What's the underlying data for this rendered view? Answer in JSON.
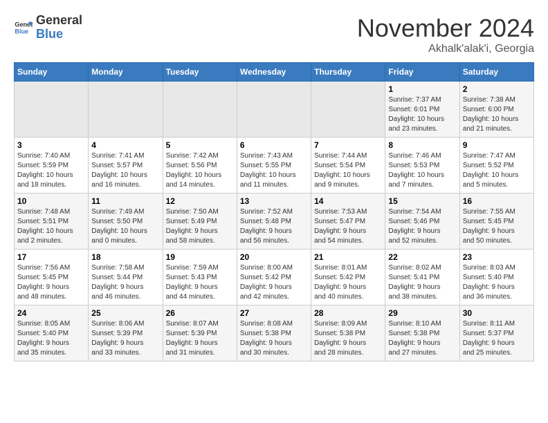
{
  "logo": {
    "line1": "General",
    "line2": "Blue"
  },
  "title": "November 2024",
  "location": "Akhalk'alak'i, Georgia",
  "days_of_week": [
    "Sunday",
    "Monday",
    "Tuesday",
    "Wednesday",
    "Thursday",
    "Friday",
    "Saturday"
  ],
  "weeks": [
    [
      {
        "num": "",
        "info": ""
      },
      {
        "num": "",
        "info": ""
      },
      {
        "num": "",
        "info": ""
      },
      {
        "num": "",
        "info": ""
      },
      {
        "num": "",
        "info": ""
      },
      {
        "num": "1",
        "info": "Sunrise: 7:37 AM\nSunset: 6:01 PM\nDaylight: 10 hours\nand 23 minutes."
      },
      {
        "num": "2",
        "info": "Sunrise: 7:38 AM\nSunset: 6:00 PM\nDaylight: 10 hours\nand 21 minutes."
      }
    ],
    [
      {
        "num": "3",
        "info": "Sunrise: 7:40 AM\nSunset: 5:59 PM\nDaylight: 10 hours\nand 18 minutes."
      },
      {
        "num": "4",
        "info": "Sunrise: 7:41 AM\nSunset: 5:57 PM\nDaylight: 10 hours\nand 16 minutes."
      },
      {
        "num": "5",
        "info": "Sunrise: 7:42 AM\nSunset: 5:56 PM\nDaylight: 10 hours\nand 14 minutes."
      },
      {
        "num": "6",
        "info": "Sunrise: 7:43 AM\nSunset: 5:55 PM\nDaylight: 10 hours\nand 11 minutes."
      },
      {
        "num": "7",
        "info": "Sunrise: 7:44 AM\nSunset: 5:54 PM\nDaylight: 10 hours\nand 9 minutes."
      },
      {
        "num": "8",
        "info": "Sunrise: 7:46 AM\nSunset: 5:53 PM\nDaylight: 10 hours\nand 7 minutes."
      },
      {
        "num": "9",
        "info": "Sunrise: 7:47 AM\nSunset: 5:52 PM\nDaylight: 10 hours\nand 5 minutes."
      }
    ],
    [
      {
        "num": "10",
        "info": "Sunrise: 7:48 AM\nSunset: 5:51 PM\nDaylight: 10 hours\nand 2 minutes."
      },
      {
        "num": "11",
        "info": "Sunrise: 7:49 AM\nSunset: 5:50 PM\nDaylight: 10 hours\nand 0 minutes."
      },
      {
        "num": "12",
        "info": "Sunrise: 7:50 AM\nSunset: 5:49 PM\nDaylight: 9 hours\nand 58 minutes."
      },
      {
        "num": "13",
        "info": "Sunrise: 7:52 AM\nSunset: 5:48 PM\nDaylight: 9 hours\nand 56 minutes."
      },
      {
        "num": "14",
        "info": "Sunrise: 7:53 AM\nSunset: 5:47 PM\nDaylight: 9 hours\nand 54 minutes."
      },
      {
        "num": "15",
        "info": "Sunrise: 7:54 AM\nSunset: 5:46 PM\nDaylight: 9 hours\nand 52 minutes."
      },
      {
        "num": "16",
        "info": "Sunrise: 7:55 AM\nSunset: 5:45 PM\nDaylight: 9 hours\nand 50 minutes."
      }
    ],
    [
      {
        "num": "17",
        "info": "Sunrise: 7:56 AM\nSunset: 5:45 PM\nDaylight: 9 hours\nand 48 minutes."
      },
      {
        "num": "18",
        "info": "Sunrise: 7:58 AM\nSunset: 5:44 PM\nDaylight: 9 hours\nand 46 minutes."
      },
      {
        "num": "19",
        "info": "Sunrise: 7:59 AM\nSunset: 5:43 PM\nDaylight: 9 hours\nand 44 minutes."
      },
      {
        "num": "20",
        "info": "Sunrise: 8:00 AM\nSunset: 5:42 PM\nDaylight: 9 hours\nand 42 minutes."
      },
      {
        "num": "21",
        "info": "Sunrise: 8:01 AM\nSunset: 5:42 PM\nDaylight: 9 hours\nand 40 minutes."
      },
      {
        "num": "22",
        "info": "Sunrise: 8:02 AM\nSunset: 5:41 PM\nDaylight: 9 hours\nand 38 minutes."
      },
      {
        "num": "23",
        "info": "Sunrise: 8:03 AM\nSunset: 5:40 PM\nDaylight: 9 hours\nand 36 minutes."
      }
    ],
    [
      {
        "num": "24",
        "info": "Sunrise: 8:05 AM\nSunset: 5:40 PM\nDaylight: 9 hours\nand 35 minutes."
      },
      {
        "num": "25",
        "info": "Sunrise: 8:06 AM\nSunset: 5:39 PM\nDaylight: 9 hours\nand 33 minutes."
      },
      {
        "num": "26",
        "info": "Sunrise: 8:07 AM\nSunset: 5:39 PM\nDaylight: 9 hours\nand 31 minutes."
      },
      {
        "num": "27",
        "info": "Sunrise: 8:08 AM\nSunset: 5:38 PM\nDaylight: 9 hours\nand 30 minutes."
      },
      {
        "num": "28",
        "info": "Sunrise: 8:09 AM\nSunset: 5:38 PM\nDaylight: 9 hours\nand 28 minutes."
      },
      {
        "num": "29",
        "info": "Sunrise: 8:10 AM\nSunset: 5:38 PM\nDaylight: 9 hours\nand 27 minutes."
      },
      {
        "num": "30",
        "info": "Sunrise: 8:11 AM\nSunset: 5:37 PM\nDaylight: 9 hours\nand 25 minutes."
      }
    ]
  ]
}
